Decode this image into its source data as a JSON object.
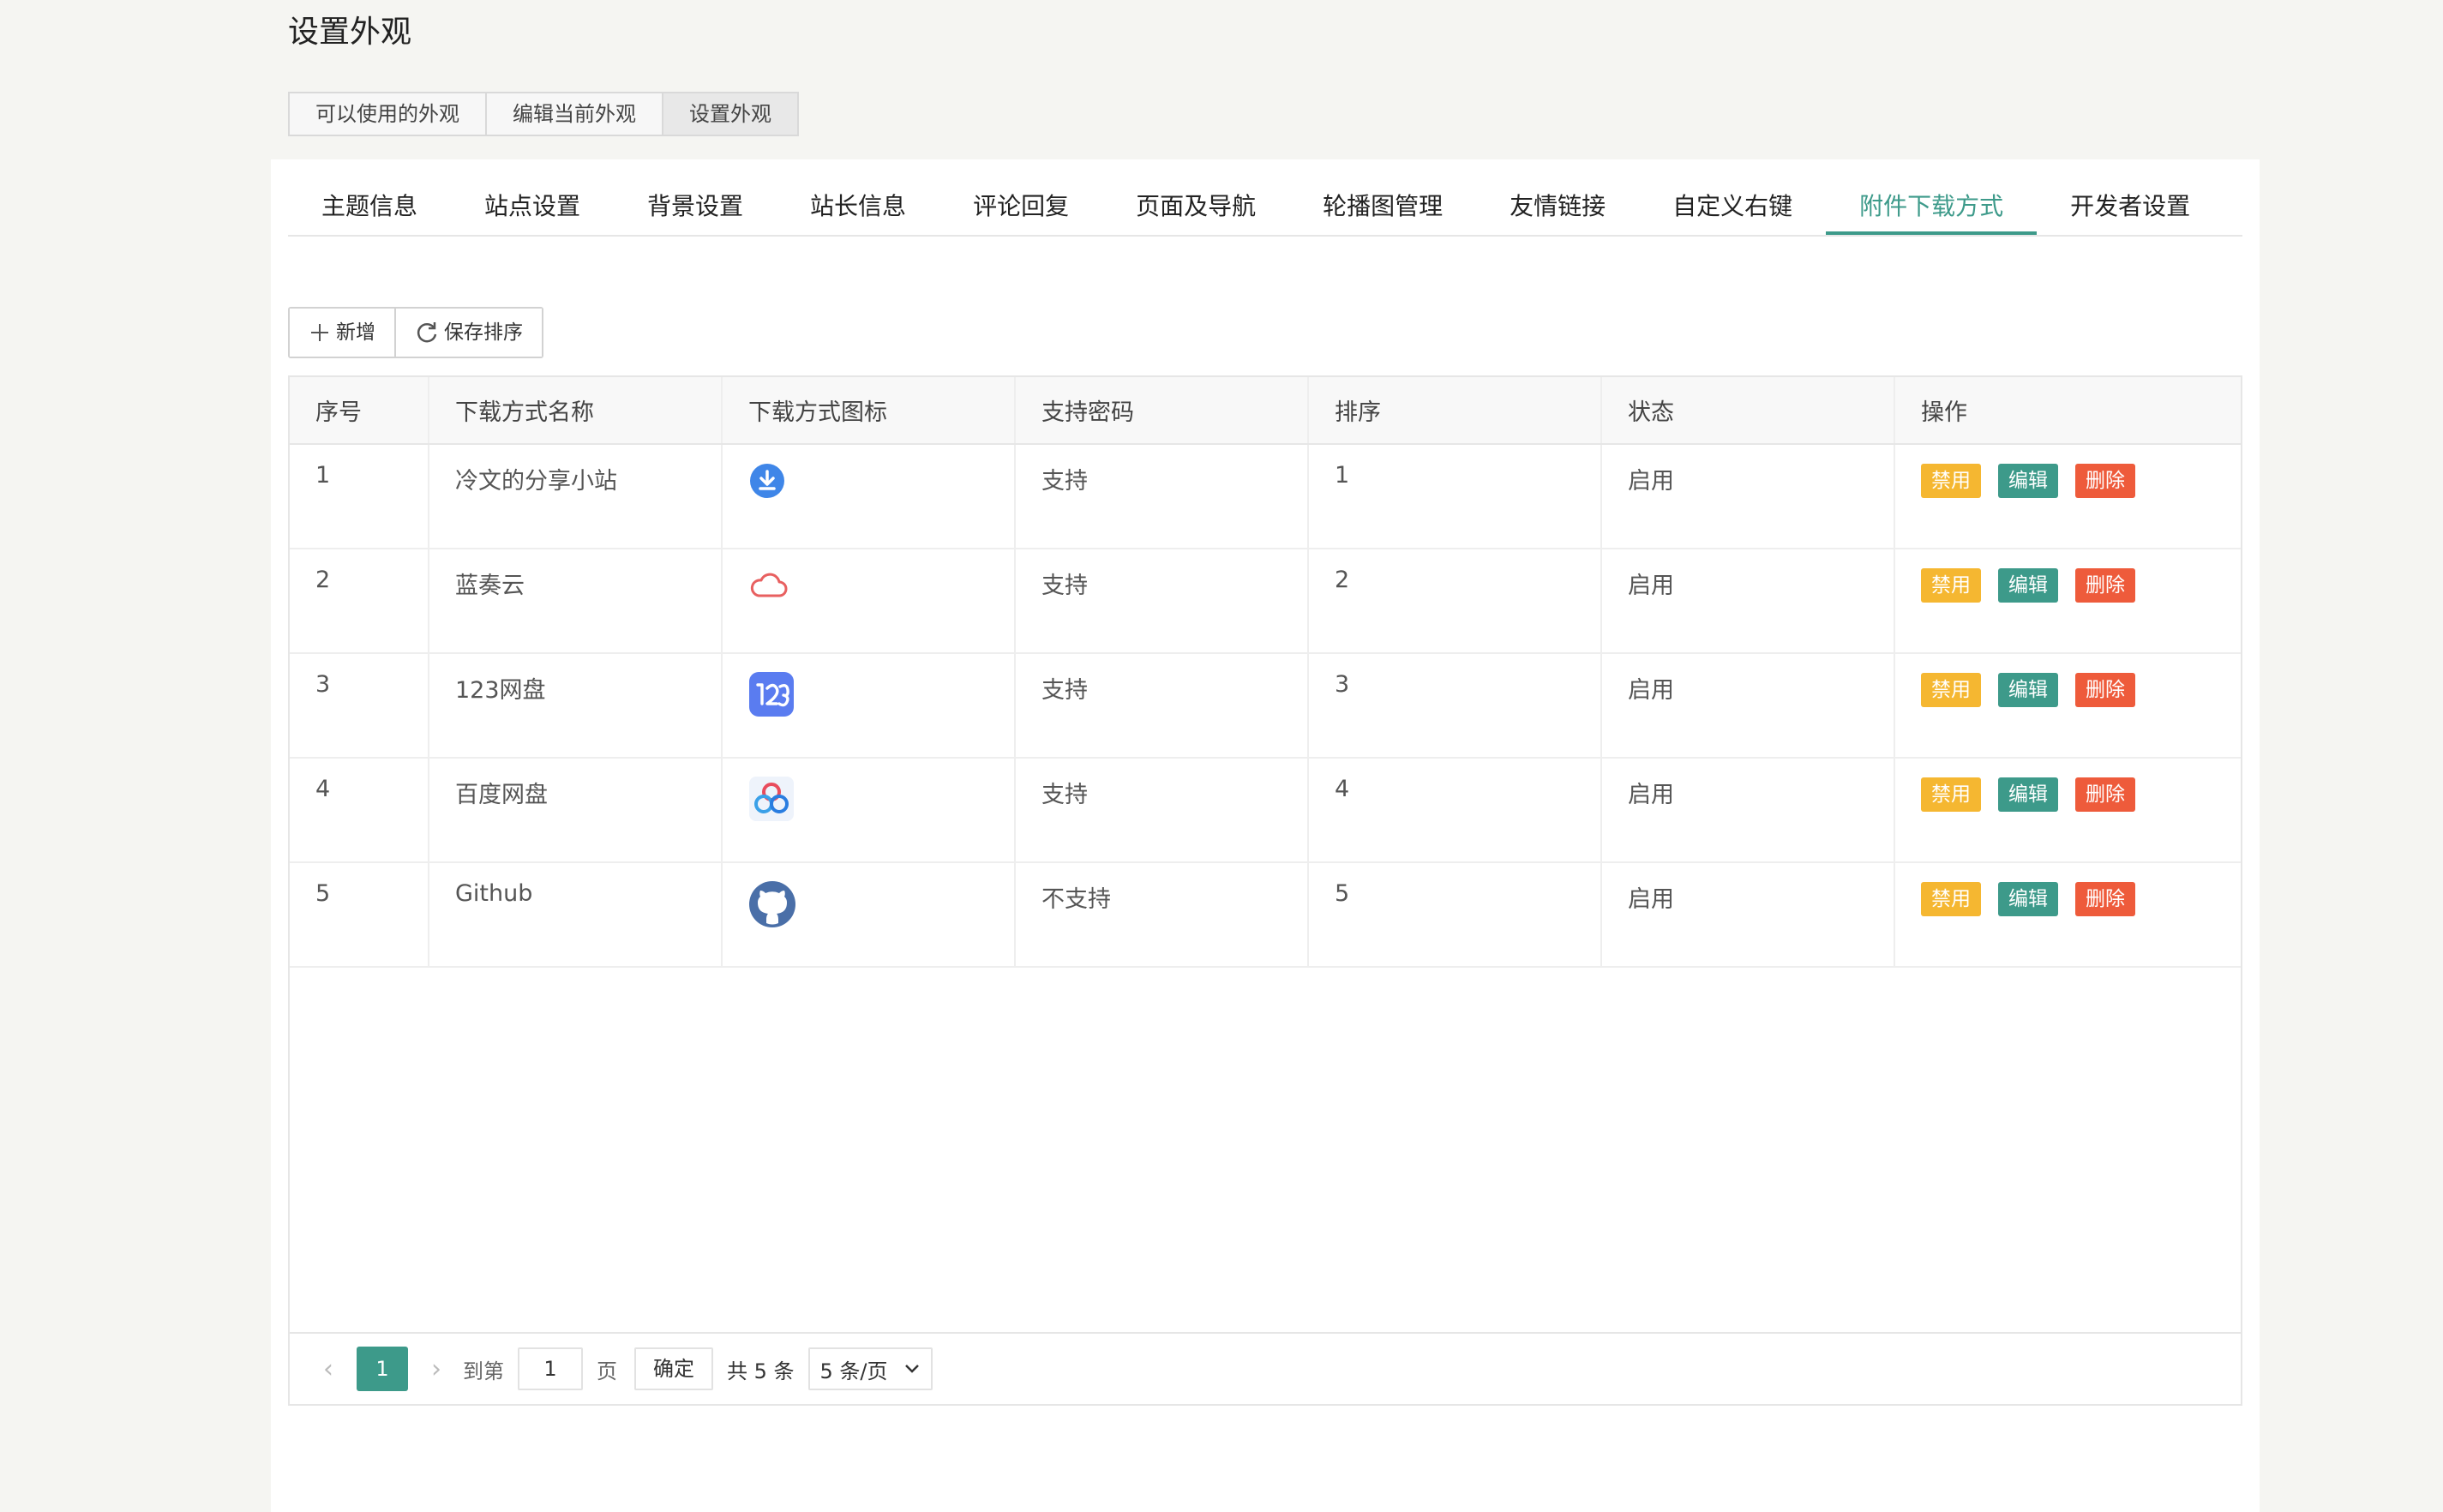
{
  "page_title": "设置外观",
  "top_tabs": [
    {
      "label": "可以使用的外观"
    },
    {
      "label": "编辑当前外观"
    },
    {
      "label": "设置外观"
    }
  ],
  "sub_tabs": [
    {
      "label": "主题信息"
    },
    {
      "label": "站点设置"
    },
    {
      "label": "背景设置"
    },
    {
      "label": "站长信息"
    },
    {
      "label": "评论回复"
    },
    {
      "label": "页面及导航"
    },
    {
      "label": "轮播图管理"
    },
    {
      "label": "友情链接"
    },
    {
      "label": "自定义右键"
    },
    {
      "label": "附件下载方式"
    },
    {
      "label": "开发者设置"
    }
  ],
  "toolbar": {
    "add_label": "新增",
    "save_label": "保存排序"
  },
  "table": {
    "headers": [
      "序号",
      "下载方式名称",
      "下载方式图标",
      "支持密码",
      "排序",
      "状态",
      "操作"
    ],
    "rows": [
      {
        "id": "1",
        "name": "冷文的分享小站",
        "icon": "download-circle-icon",
        "password": "支持",
        "order": "1",
        "status": "启用"
      },
      {
        "id": "2",
        "name": "蓝奏云",
        "icon": "cloud-icon",
        "password": "支持",
        "order": "2",
        "status": "启用"
      },
      {
        "id": "3",
        "name": "123网盘",
        "icon": "pan123-icon",
        "password": "支持",
        "order": "3",
        "status": "启用"
      },
      {
        "id": "4",
        "name": "百度网盘",
        "icon": "baidu-pan-icon",
        "password": "支持",
        "order": "4",
        "status": "启用"
      },
      {
        "id": "5",
        "name": "Github",
        "icon": "github-icon",
        "password": "不支持",
        "order": "5",
        "status": "启用"
      }
    ],
    "actions": {
      "disable": "禁用",
      "edit": "编辑",
      "delete": "删除"
    }
  },
  "pager": {
    "current": "1",
    "goto_label": "到第",
    "page_input": "1",
    "page_unit": "页",
    "confirm": "确定",
    "total": "共 5 条",
    "page_size": "5 条/页"
  },
  "colors": {
    "accent": "#3d9a8a",
    "warn": "#f5b731",
    "danger": "#ee5b3b"
  }
}
